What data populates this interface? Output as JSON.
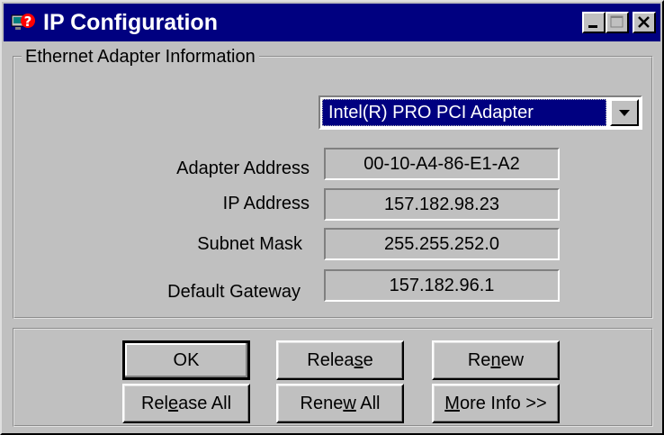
{
  "window": {
    "title": "IP Configuration",
    "icon": "ip-config-icon",
    "caption_buttons": [
      "minimize-icon",
      "maximize-icon",
      "close-icon"
    ]
  },
  "group": {
    "label": "Ethernet  Adapter Information"
  },
  "adapter_select": {
    "selected": "Intel(R) PRO PCI Adapter"
  },
  "fields": [
    {
      "label": "Adapter Address",
      "value": "00-10-A4-86-E1-A2"
    },
    {
      "label": "IP Address",
      "value": "157.182.98.23"
    },
    {
      "label": "Subnet Mask",
      "value": "255.255.252.0"
    },
    {
      "label": "Default Gateway",
      "value": "157.182.96.1"
    }
  ],
  "buttons": {
    "ok": {
      "pre": "OK",
      "u": "",
      "post": ""
    },
    "release": {
      "pre": "Relea",
      "u": "s",
      "post": "e"
    },
    "renew": {
      "pre": "Re",
      "u": "n",
      "post": "ew"
    },
    "release_all": {
      "pre": "Rel",
      "u": "e",
      "post": "ase All"
    },
    "renew_all": {
      "pre": "Rene",
      "u": "w",
      "post": " All"
    },
    "more_info": {
      "pre": "",
      "u": "M",
      "post": "ore Info >>"
    }
  },
  "colors": {
    "titlebar": "#000080",
    "face": "#c0c0c0",
    "selection": "#000080"
  }
}
